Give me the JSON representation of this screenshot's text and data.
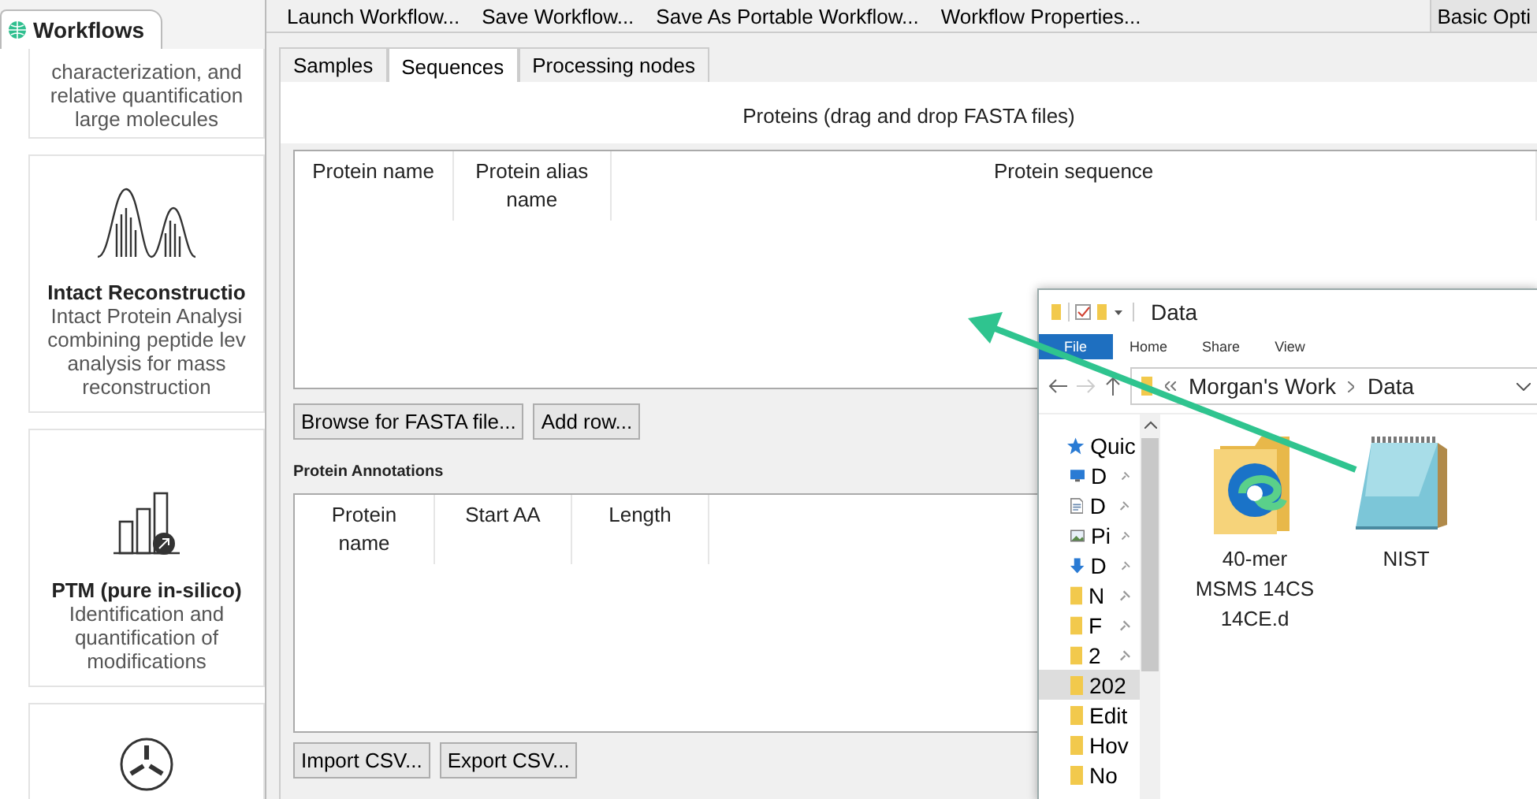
{
  "sidebar": {
    "tab": "Workflows",
    "cards": [
      {
        "kind": "text",
        "lines": [
          "characterization, and",
          "relative quantification",
          "large molecules"
        ]
      },
      {
        "kind": "peaks",
        "title": "Intact Reconstructio",
        "lines": [
          "Intact Protein Analysi",
          "combining peptide lev",
          "analysis for mass",
          "reconstruction"
        ]
      },
      {
        "kind": "bars",
        "title": "PTM (pure in-silico)",
        "lines": [
          "Identification and",
          "quantification of",
          "modifications"
        ]
      },
      {
        "kind": "radial"
      }
    ]
  },
  "toolbar": {
    "buttons": [
      "Launch Workflow...",
      "Save Workflow...",
      "Save As Portable Workflow...",
      "Workflow Properties..."
    ],
    "options_button": "Basic Opti"
  },
  "tabs": [
    {
      "label": "Samples",
      "selected": false
    },
    {
      "label": "Sequences",
      "selected": true
    },
    {
      "label": "Processing nodes",
      "selected": false
    }
  ],
  "proteins": {
    "title": "Proteins (drag and drop FASTA files)",
    "columns": [
      "Protein name",
      "Protein alias name",
      "Protein sequence"
    ],
    "buttons": [
      "Browse for FASTA file...",
      "Add row..."
    ]
  },
  "annotations": {
    "title": "Protein Annotations",
    "columns": [
      "Protein name",
      "Start AA",
      "Length"
    ],
    "buttons": [
      "Import CSV...",
      "Export CSV..."
    ]
  },
  "explorer": {
    "title": "Data",
    "ribbon_tabs": [
      {
        "label": "File",
        "selected": true
      },
      {
        "label": "Home",
        "selected": false
      },
      {
        "label": "Share",
        "selected": false
      },
      {
        "label": "View",
        "selected": false
      }
    ],
    "path": [
      "Morgan's Work",
      "Data"
    ],
    "nav_items": [
      {
        "label": "Quic",
        "kind": "star",
        "pinned": false,
        "selected": false
      },
      {
        "label": "D",
        "kind": "desktop",
        "pinned": true,
        "selected": false
      },
      {
        "label": "D",
        "kind": "document",
        "pinned": true,
        "selected": false
      },
      {
        "label": "Pi",
        "kind": "picture",
        "pinned": true,
        "selected": false
      },
      {
        "label": "D",
        "kind": "download",
        "pinned": true,
        "selected": false
      },
      {
        "label": "N",
        "kind": "folder",
        "pinned": true,
        "selected": false
      },
      {
        "label": "F",
        "kind": "folder",
        "pinned": true,
        "selected": false
      },
      {
        "label": "2",
        "kind": "folder",
        "pinned": true,
        "selected": false
      },
      {
        "label": "202",
        "kind": "folder",
        "pinned": false,
        "selected": true
      },
      {
        "label": "Edit",
        "kind": "folder",
        "pinned": false,
        "selected": false
      },
      {
        "label": "Hov",
        "kind": "folder",
        "pinned": false,
        "selected": false
      },
      {
        "label": "No",
        "kind": "folder",
        "pinned": false,
        "selected": false
      }
    ],
    "files": [
      {
        "name": "40-mer MSMS 14CS 14CE.d",
        "kind": "folder"
      },
      {
        "name": "NIST",
        "kind": "notepad"
      }
    ]
  }
}
